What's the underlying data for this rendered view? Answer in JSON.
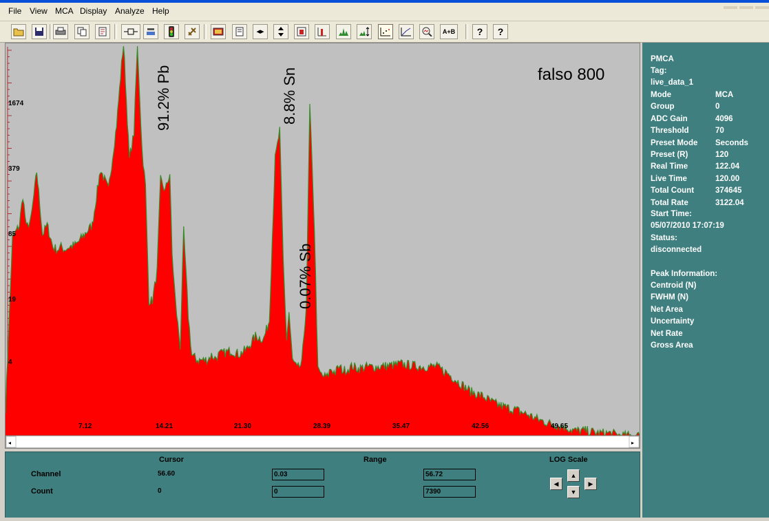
{
  "menu": [
    "File",
    "View",
    "MCA",
    "Display",
    "Analyze",
    "Help"
  ],
  "toolbar_icons": [
    "open-icon",
    "save-icon",
    "print-icon",
    "copy-icon",
    "report-icon",
    "connect-icon",
    "acquire-icon",
    "traffic-light-icon",
    "clear-icon",
    "spectrum-color-icon",
    "page-icon",
    "expand-horizontal-icon",
    "expand-vertical-icon",
    "fit-icon",
    "bar-plot-icon",
    "peak-plot-icon",
    "autoscale-icon",
    "dot-plot-icon",
    "line-plot-icon",
    "zoom-icon",
    "sum-icon",
    "help-icon",
    "context-help-icon"
  ],
  "toolbar_text": {
    "sum": "A+B",
    "help": "?",
    "context_help": "?"
  },
  "plot": {
    "label_pb": "91.2% Pb",
    "label_sn": "8.8% Sn",
    "label_sb": "0.07% Sb",
    "label_sample": "falso 800",
    "y_ticks": [
      "1674",
      "379",
      "85",
      "19",
      "4"
    ],
    "x_ticks": [
      "7.12",
      "14.21",
      "21.30",
      "28.39",
      "35.47",
      "42.56",
      "49.65"
    ],
    "fill_color": "#ff0000",
    "edge_color": "#3a8a2a",
    "background": "#c0c0c0"
  },
  "chart_data": {
    "type": "area",
    "title": "falso 800",
    "xlabel": "",
    "ylabel": "",
    "log_scale": true,
    "xlim": [
      0.8,
      55.6
    ],
    "ylim": [
      1.8,
      7200
    ],
    "y_ticks": [
      4,
      19,
      85,
      379,
      1674
    ],
    "x_ticks": [
      7.12,
      14.21,
      21.3,
      28.39,
      35.47,
      42.56,
      49.65
    ],
    "annotations": [
      "91.2% Pb",
      "8.8% Sn",
      "0.07% Sb"
    ],
    "x": [
      0.8,
      1.4,
      2.0,
      2.3,
      2.6,
      3.0,
      3.5,
      4.0,
      4.4,
      4.9,
      5.3,
      5.6,
      5.9,
      6.3,
      6.9,
      7.6,
      8.3,
      9.0,
      9.7,
      10.4,
      11.0,
      11.5,
      11.9,
      12.2,
      12.6,
      12.9,
      13.2,
      13.5,
      13.9,
      14.2,
      14.6,
      15.0,
      15.2,
      15.5,
      15.9,
      16.2,
      16.6,
      16.9,
      17.4,
      17.9,
      18.3,
      18.6,
      18.9,
      19.3,
      19.7,
      20.3,
      21.0,
      21.7,
      22.4,
      23.1,
      23.6,
      24.1,
      24.5,
      24.8,
      25.1,
      25.3,
      25.6,
      26.0,
      26.4,
      26.8,
      27.1,
      27.5,
      27.8,
      28.2,
      28.6,
      28.9,
      29.3,
      29.6,
      30.0,
      30.4,
      30.8,
      31.3,
      32.0,
      33.0,
      34.0,
      35.0,
      36.0,
      37.0,
      38.0,
      39.0,
      40.0,
      41.0,
      42.0,
      43.0,
      44.0,
      45.0,
      46.0,
      47.0,
      48.0,
      49.0,
      50.0,
      51.0,
      52.0,
      53.0,
      54.0,
      54.8,
      55.6
    ],
    "y": [
      3.2,
      120,
      160,
      300,
      150,
      180,
      500,
      130,
      160,
      100,
      95,
      100,
      95,
      100,
      105,
      130,
      160,
      520,
      340,
      1350,
      8000,
      650,
      1130,
      7500,
      800,
      360,
      32,
      32,
      60,
      420,
      330,
      480,
      85,
      30,
      12,
      140,
      23,
      10,
      9,
      9,
      9.2,
      10,
      9.4,
      10.2,
      10.5,
      11,
      10.2,
      11.5,
      15,
      14,
      21,
      650,
      1200,
      75,
      14,
      25,
      9,
      7.5,
      8.2,
      30,
      2000,
      150,
      7.2,
      6.4,
      6.3,
      7.5,
      6.9,
      7.8,
      7.2,
      7.5,
      7.9,
      7.5,
      7.8,
      7.8,
      8.0,
      8.3,
      8.0,
      7.8,
      7.9,
      6.8,
      5.6,
      4.6,
      4.2,
      3.6,
      3.3,
      3.1,
      2.8,
      2.5,
      2.3,
      2.2,
      2.0,
      2.0,
      1.9,
      1.9,
      1.8,
      1.8,
      1.8
    ]
  },
  "right_panel": {
    "app": "PMCA",
    "tag_label": "Tag:",
    "tag_value": "live_data_1",
    "rows": [
      {
        "label": "Mode",
        "value": "MCA"
      },
      {
        "label": "Group",
        "value": "0"
      },
      {
        "label": "ADC Gain",
        "value": "4096"
      },
      {
        "label": "Threshold",
        "value": "70"
      },
      {
        "label": "Preset Mode",
        "value": "Seconds"
      },
      {
        "label": "Preset (R)",
        "value": "120"
      },
      {
        "label": "Real Time",
        "value": "122.04"
      },
      {
        "label": "Live Time",
        "value": "120.00"
      },
      {
        "label": "Total Count",
        "value": "374645"
      },
      {
        "label": "Total Rate",
        "value": "3122.04"
      }
    ],
    "start_time_label": "Start Time:",
    "start_time_value": "05/07/2010 17:07:19",
    "status_label": "Status:",
    "status_value": "disconnected",
    "peak_info_label": "Peak Information:",
    "peak_rows": [
      "Centroid (N)",
      "FWHM (N)",
      "Net Area",
      "Uncertainty",
      "Net Rate",
      "Gross Area"
    ]
  },
  "bottom_panel": {
    "cursor_header": "Cursor",
    "range_header": "Range",
    "log_header": "LOG Scale",
    "channel_label": "Channel",
    "count_label": "Count",
    "cursor_channel": "56.60",
    "cursor_count": "0",
    "range_channel_low": "0.03",
    "range_channel_high": "56.72",
    "range_count_low": "0",
    "range_count_high": "7390"
  }
}
